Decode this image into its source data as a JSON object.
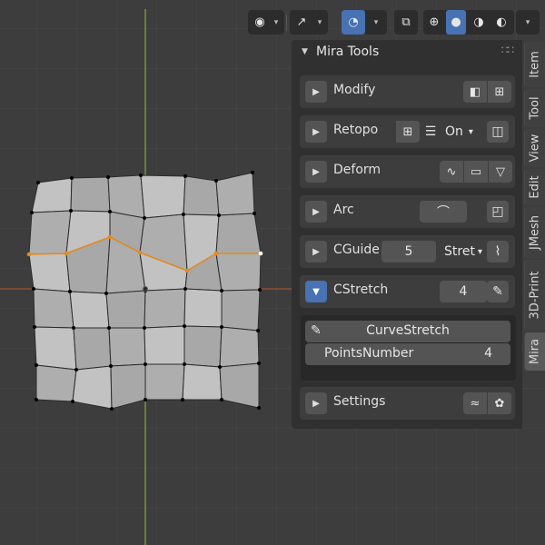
{
  "header": {
    "icons": [
      "eye-icon",
      "gizmo-icon",
      "overlay-icon",
      "xray-icon",
      "wireframe-shading-icon",
      "solid-shading-icon",
      "material-shading-icon",
      "rendered-shading-icon"
    ]
  },
  "panel": {
    "title": "Mira Tools",
    "subpanels": {
      "modify": {
        "label": "Modify"
      },
      "retopo": {
        "label": "Retopo",
        "value": "On"
      },
      "deform": {
        "label": "Deform"
      },
      "arc": {
        "label": "Arc"
      },
      "cguide": {
        "label": "CGuide",
        "number": "5",
        "dropdown": "Stret"
      },
      "cstretch": {
        "label": "CStretch",
        "number": "4",
        "button": "CurveStretch",
        "param_label": "PointsNumber",
        "param_value": "4"
      },
      "settings": {
        "label": "Settings"
      }
    }
  },
  "tabs": [
    "Item",
    "Tool",
    "View",
    "Edit",
    "JMesh",
    "3D-Print",
    "Mira"
  ],
  "colors": {
    "selection": "#e58b1a",
    "axis_x": "#e0763c",
    "axis_y": "#9bc130",
    "active": "#4772b3"
  }
}
